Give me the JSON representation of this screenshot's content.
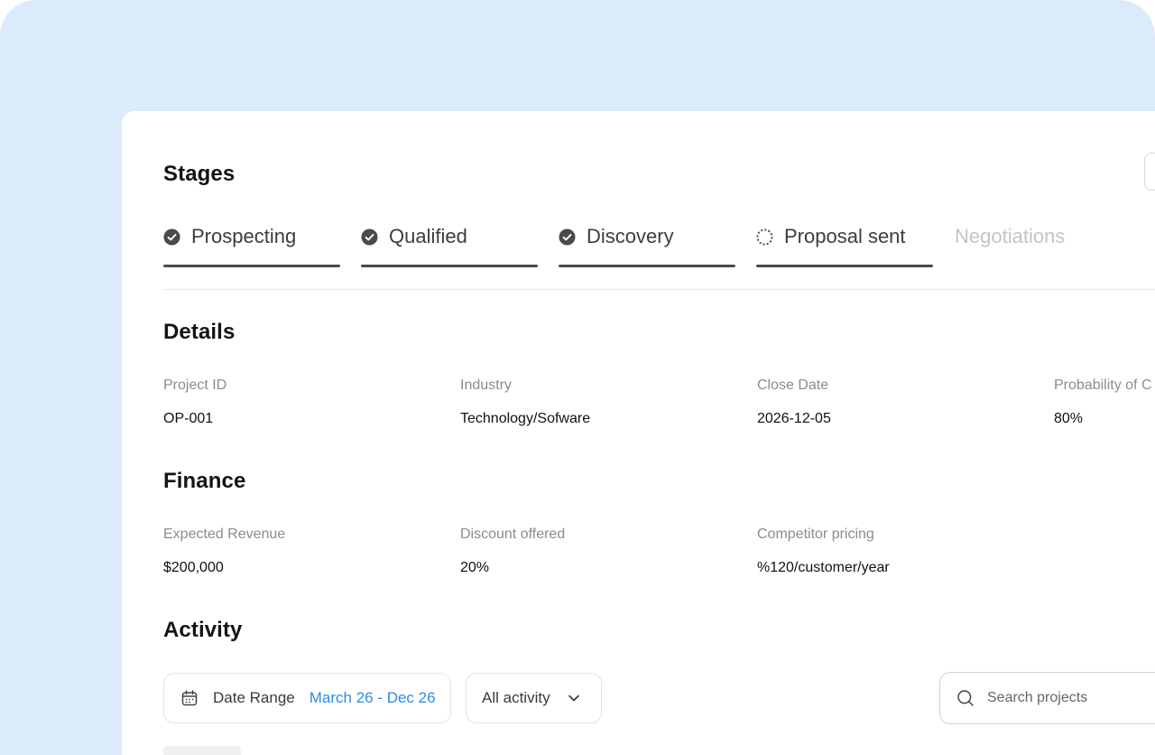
{
  "sections": {
    "stages_title": "Stages",
    "details_title": "Details",
    "finance_title": "Finance",
    "activity_title": "Activity"
  },
  "stages": [
    {
      "label": "Prospecting",
      "status": "complete"
    },
    {
      "label": "Qualified",
      "status": "complete"
    },
    {
      "label": "Discovery",
      "status": "complete"
    },
    {
      "label": "Proposal sent",
      "status": "in-progress"
    },
    {
      "label": "Negotiations",
      "status": "upcoming"
    }
  ],
  "details": {
    "fields": [
      {
        "label": "Project ID",
        "value": "OP-001"
      },
      {
        "label": "Industry",
        "value": "Technology/Sofware"
      },
      {
        "label": "Close Date",
        "value": "2026-12-05"
      },
      {
        "label": "Probability of C",
        "value": "80%"
      }
    ]
  },
  "finance": {
    "fields": [
      {
        "label": "Expected Revenue",
        "value": "$200,000"
      },
      {
        "label": "Discount offered",
        "value": "20%"
      },
      {
        "label": "Competitor pricing",
        "value": "%120/customer/year"
      }
    ]
  },
  "activity": {
    "date_range_label": "Date Range",
    "date_range_value": "March 26 - Dec 26",
    "filter_value": "All activity",
    "search_placeholder": "Search projects"
  },
  "colors": {
    "backdrop": "#dcebfc",
    "accent": "#2b8be6",
    "stage_active": "#4a4a4a",
    "stage_upcoming": "#c4c4c4"
  },
  "icons": {
    "stage_complete": "check-circle-icon",
    "stage_in_progress": "dashed-circle-icon",
    "date": "calendar-icon",
    "filter": "chevron-down-icon",
    "search": "search-icon"
  }
}
